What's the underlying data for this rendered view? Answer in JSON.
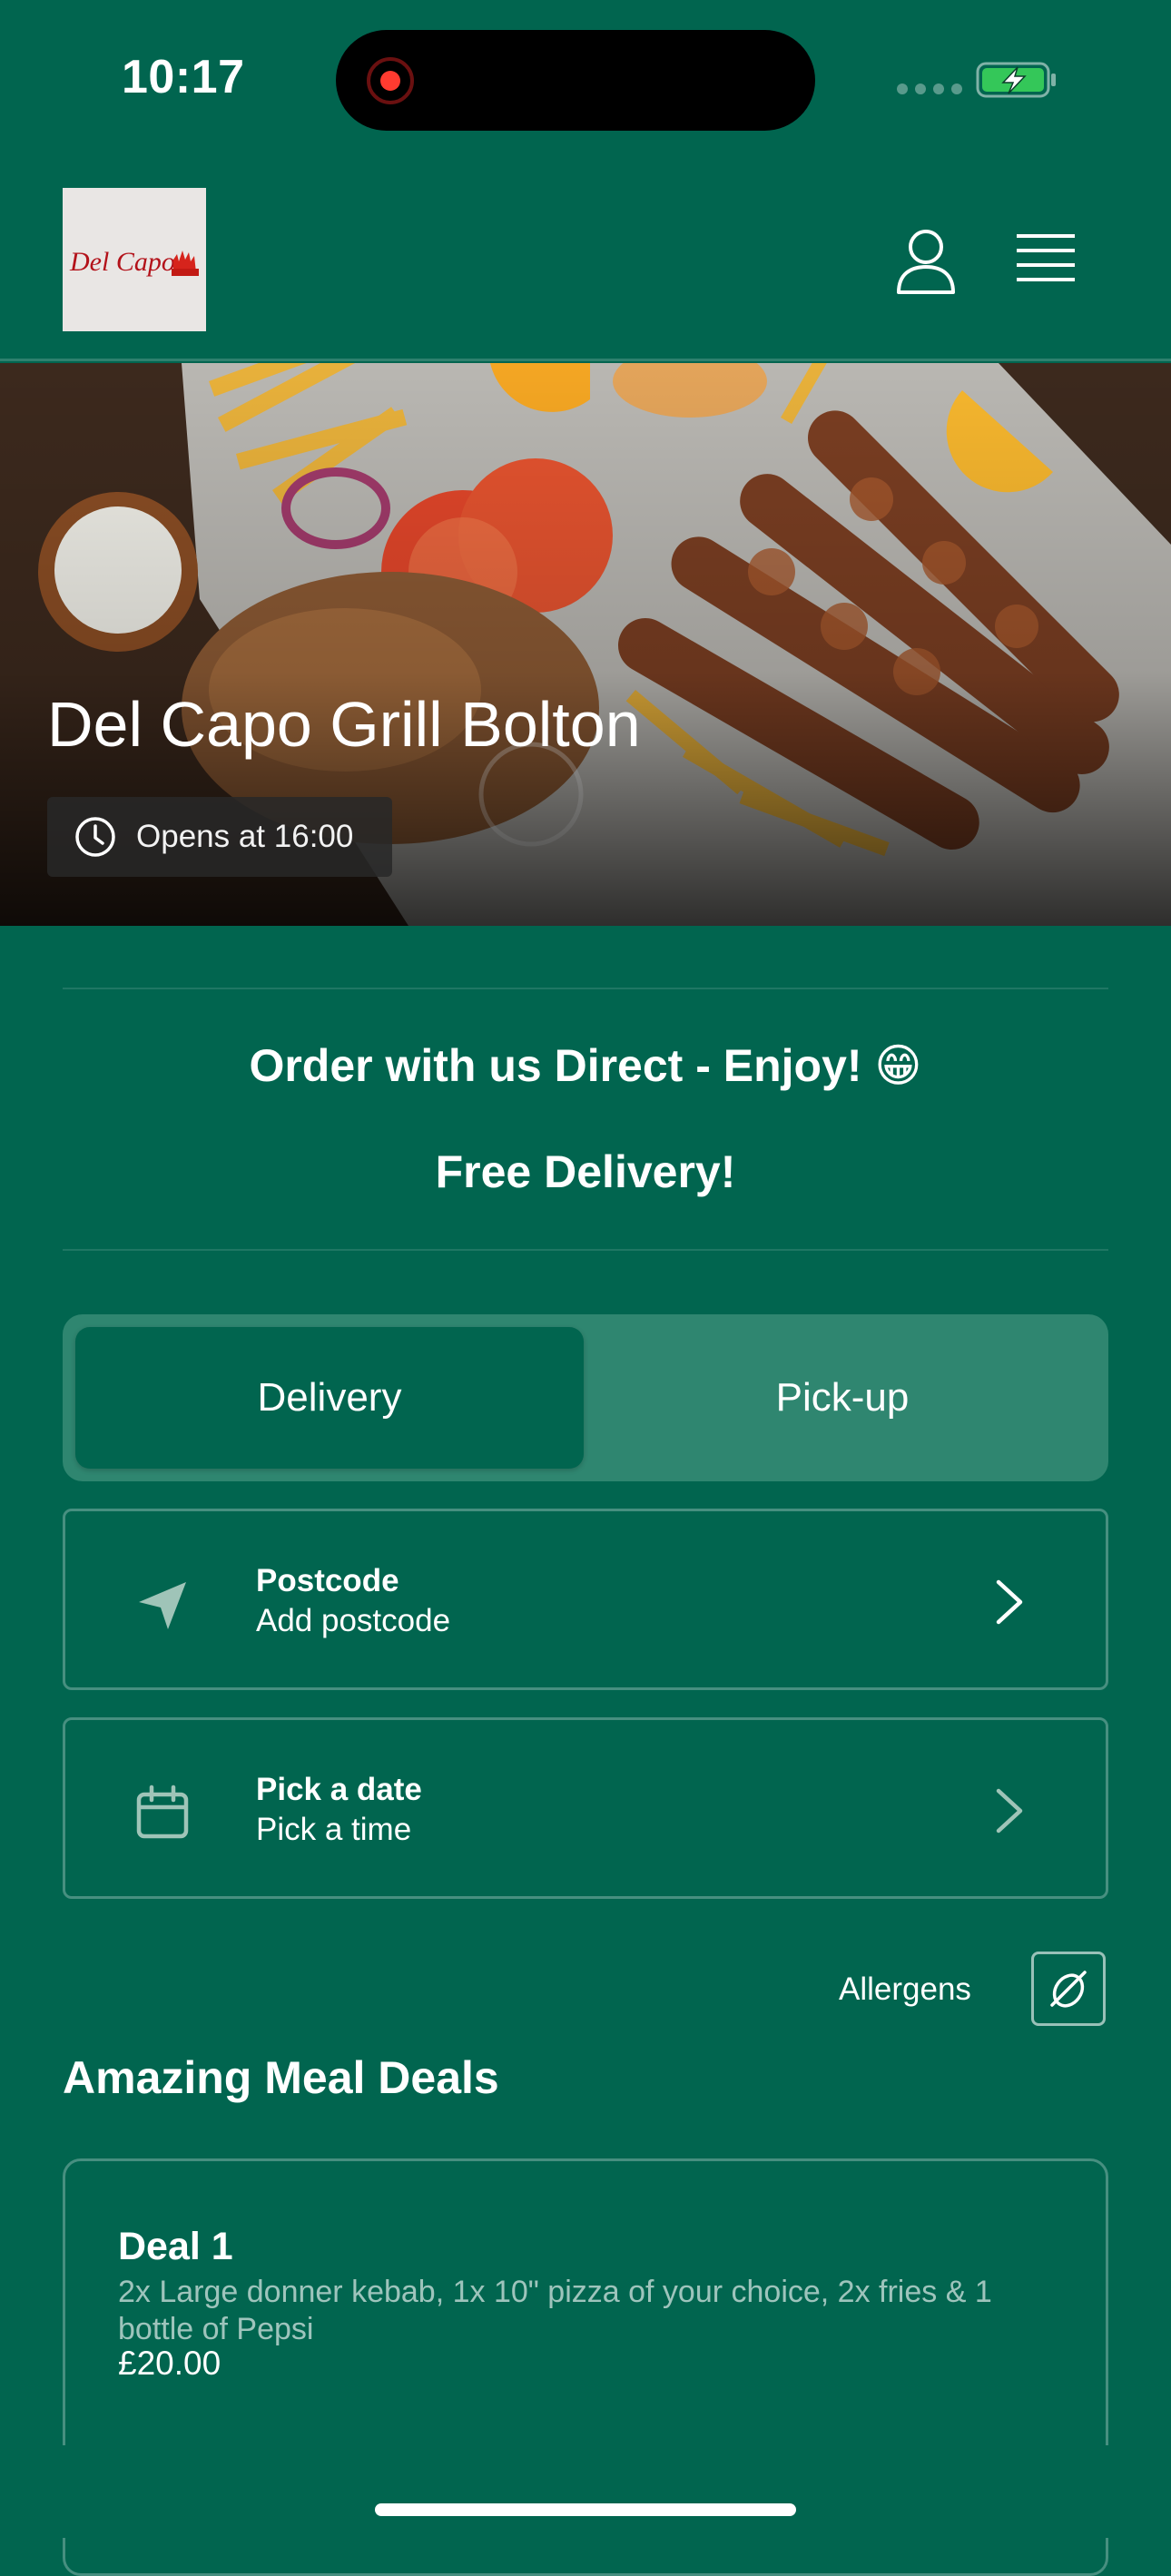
{
  "status_bar": {
    "time": "10:17"
  },
  "header": {
    "logo_text": "Del Capo",
    "profile_icon": "user-icon",
    "menu_icon": "hamburger-menu-icon"
  },
  "hero": {
    "restaurant_name": "Del Capo Grill Bolton",
    "opening_status": "Opens at 16:00",
    "status_icon": "clock-icon"
  },
  "promo": {
    "line1": "Order with us Direct - Enjoy! 😁",
    "line2": "Free Delivery!"
  },
  "order_mode": {
    "options": [
      {
        "label": "Delivery",
        "selected": true
      },
      {
        "label": "Pick-up",
        "selected": false
      }
    ]
  },
  "postcode_row": {
    "title": "Postcode",
    "subtitle": "Add postcode",
    "icon": "location-arrow-icon"
  },
  "date_row": {
    "title": "Pick a date",
    "subtitle": "Pick a time",
    "icon": "calendar-icon"
  },
  "allergens": {
    "label": "Allergens",
    "icon": "allergens-icon"
  },
  "menu_section": {
    "title": "Amazing Meal Deals",
    "items": [
      {
        "name": "Deal 1",
        "description": "2x Large donner kebab, 1x 10\" pizza of your choice, 2x fries & 1 bottle of Pepsi",
        "price": "£20.00"
      }
    ]
  },
  "colors": {
    "background": "#01654f",
    "toggle_track": "#2f8670",
    "text": "#ffffff"
  }
}
